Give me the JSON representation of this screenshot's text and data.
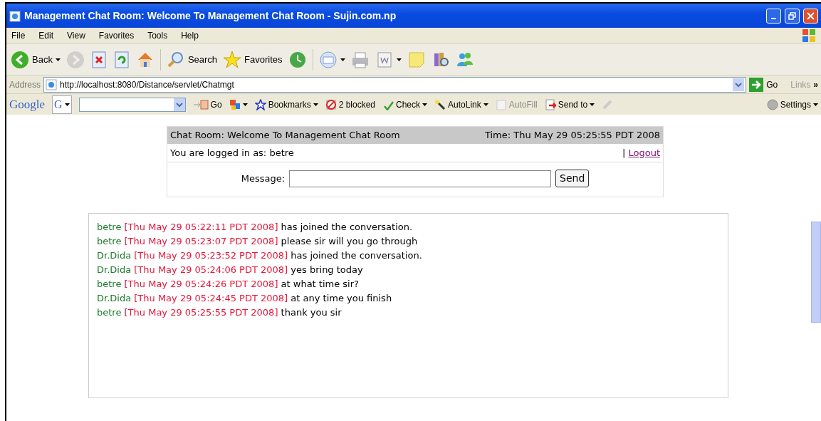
{
  "window": {
    "title": "Management Chat Room: Welcome To Management Chat Room - Sujin.com.np"
  },
  "menu": [
    "File",
    "Edit",
    "View",
    "Favorites",
    "Tools",
    "Help"
  ],
  "toolbar": [
    {
      "kind": "back",
      "label": "Back",
      "dropdown": true
    },
    {
      "kind": "forward",
      "disabled": true
    },
    {
      "kind": "stop"
    },
    {
      "kind": "refresh"
    },
    {
      "kind": "home"
    },
    {
      "kind": "search",
      "label": "Search"
    },
    {
      "kind": "favorites",
      "label": "Favorites"
    },
    {
      "kind": "history"
    },
    {
      "kind": "mail",
      "dropdown": true
    },
    {
      "kind": "print"
    },
    {
      "kind": "edit",
      "dropdown": true
    },
    {
      "kind": "note"
    },
    {
      "kind": "research"
    },
    {
      "kind": "messenger"
    }
  ],
  "address": {
    "label": "Address",
    "url": "http://localhost:8080/Distance/servlet/Chatmgt",
    "go": "Go",
    "links": "Links",
    "more": "»"
  },
  "google_toolbar": {
    "logo": "Google",
    "g_button": "G",
    "items": [
      {
        "kind": "go",
        "label": "Go",
        "disabled": false
      },
      {
        "kind": "popup",
        "disabled": false
      },
      {
        "kind": "bookmarks",
        "label": "Bookmarks",
        "disabled": false
      },
      {
        "kind": "blocked",
        "label": "2 blocked",
        "disabled": false
      },
      {
        "kind": "check",
        "label": "Check",
        "disabled": false
      },
      {
        "kind": "autolink",
        "label": "AutoLink",
        "disabled": false
      },
      {
        "kind": "autofill",
        "label": "AutoFill",
        "disabled": true
      },
      {
        "kind": "sendto",
        "label": "Send to",
        "disabled": false
      }
    ],
    "settings": "Settings"
  },
  "chat": {
    "title": "Chat Room: Welcome To Management Chat Room",
    "time": "Time: Thu May 29 05:25:55 PDT 2008",
    "logged_in": "You are logged in as: betre",
    "separator": "|",
    "logout": "Logout",
    "message_label": "Message:",
    "send": "Send",
    "messages": [
      {
        "user": "betre",
        "time": "[Thu May 29 05:22:11 PDT 2008]",
        "text": "has joined the conversation."
      },
      {
        "user": "betre",
        "time": "[Thu May 29 05:23:07 PDT 2008]",
        "text": "please sir will you go through"
      },
      {
        "user": "Dr.Dida",
        "time": "[Thu May 29 05:23:52 PDT 2008]",
        "text": "has joined the conversation."
      },
      {
        "user": "Dr.Dida",
        "time": "[Thu May 29 05:24:06 PDT 2008]",
        "text": "yes bring today"
      },
      {
        "user": "betre",
        "time": "[Thu May 29 05:24:26 PDT 2008]",
        "text": "at what time sir?"
      },
      {
        "user": "Dr.Dida",
        "time": "[Thu May 29 05:24:45 PDT 2008]",
        "text": "at any time you finish"
      },
      {
        "user": "betre",
        "time": "[Thu May 29 05:25:55 PDT 2008]",
        "text": "thank you sir"
      }
    ]
  }
}
